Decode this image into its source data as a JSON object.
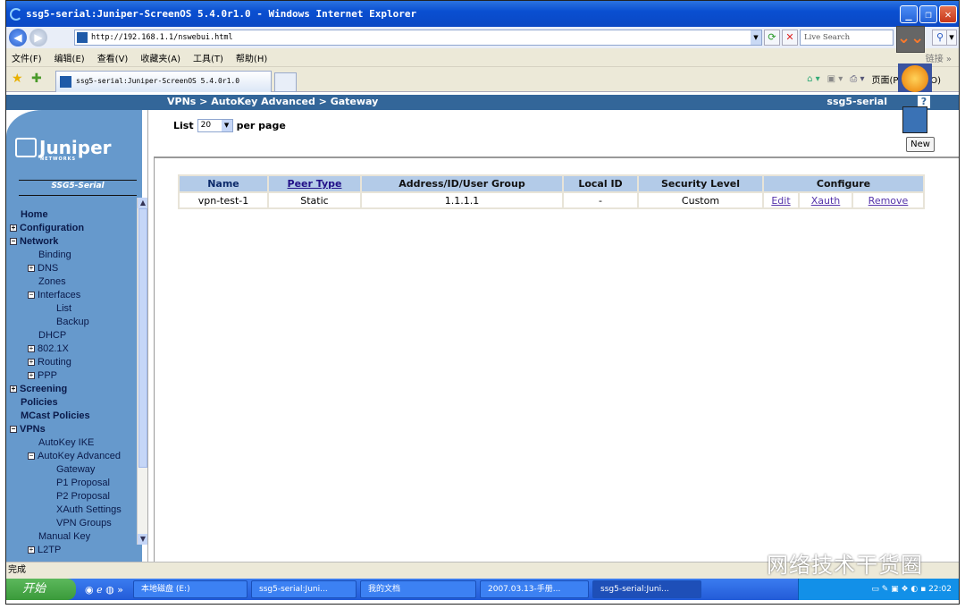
{
  "window": {
    "title": "ssg5-serial:Juniper-ScreenOS 5.4.0r1.0 - Windows Internet Explorer",
    "controls": [
      "_",
      "❐",
      "✕"
    ]
  },
  "address_bar": {
    "url": "http://192.168.1.1/nswebui.html",
    "search_placeholder": "Live Search"
  },
  "menu": {
    "items": [
      "文件(F)",
      "编辑(E)",
      "查看(V)",
      "收藏夹(A)",
      "工具(T)",
      "帮助(H)"
    ],
    "links_label": "链接 »"
  },
  "tab_bar": {
    "tab_title": "ssg5-serial:Juniper-ScreenOS 5.4.0r1.0",
    "page_menu": "页面(P)",
    "tools_menu": "工具(O)"
  },
  "header": {
    "breadcrumb": "VPNs > AutoKey Advanced > Gateway",
    "device_name": "ssg5-serial",
    "help": "?"
  },
  "sidebar": {
    "logo": "Juniper",
    "logo_sub": "NETWORKS",
    "model": "SSG5-Serial",
    "tree": [
      {
        "label": "Home",
        "bold": true,
        "level": 0,
        "toggle": ""
      },
      {
        "label": "Configuration",
        "bold": true,
        "level": 0,
        "toggle": "+"
      },
      {
        "label": "Network",
        "bold": true,
        "level": 0,
        "toggle": "−"
      },
      {
        "label": "Binding",
        "level": 1,
        "toggle": ""
      },
      {
        "label": "DNS",
        "level": 1,
        "toggle": "+"
      },
      {
        "label": "Zones",
        "level": 1,
        "toggle": ""
      },
      {
        "label": "Interfaces",
        "level": 1,
        "toggle": "−"
      },
      {
        "label": "List",
        "level": 2,
        "toggle": ""
      },
      {
        "label": "Backup",
        "level": 2,
        "toggle": ""
      },
      {
        "label": "DHCP",
        "level": 1,
        "toggle": ""
      },
      {
        "label": "802.1X",
        "level": 1,
        "toggle": "+"
      },
      {
        "label": "Routing",
        "level": 1,
        "toggle": "+"
      },
      {
        "label": "PPP",
        "level": 1,
        "toggle": "+"
      },
      {
        "label": "Screening",
        "bold": true,
        "level": 0,
        "toggle": "+"
      },
      {
        "label": "Policies",
        "bold": true,
        "level": 0,
        "toggle": ""
      },
      {
        "label": "MCast Policies",
        "bold": true,
        "level": 0,
        "toggle": ""
      },
      {
        "label": "VPNs",
        "bold": true,
        "level": 0,
        "toggle": "−"
      },
      {
        "label": "AutoKey IKE",
        "level": 1,
        "toggle": ""
      },
      {
        "label": "AutoKey Advanced",
        "level": 1,
        "toggle": "−"
      },
      {
        "label": "Gateway",
        "level": 2,
        "toggle": ""
      },
      {
        "label": "P1 Proposal",
        "level": 2,
        "toggle": ""
      },
      {
        "label": "P2 Proposal",
        "level": 2,
        "toggle": ""
      },
      {
        "label": "XAuth Settings",
        "level": 2,
        "toggle": ""
      },
      {
        "label": "VPN Groups",
        "level": 2,
        "toggle": ""
      },
      {
        "label": "Manual Key",
        "level": 1,
        "toggle": ""
      },
      {
        "label": "L2TP",
        "level": 1,
        "toggle": "+"
      }
    ]
  },
  "content": {
    "list_label": "List",
    "per_page_value": "20",
    "per_page_label": "per page",
    "new_button": "New",
    "table": {
      "headers": [
        "Name",
        "Peer Type",
        "Address/ID/User Group",
        "Local ID",
        "Security Level",
        "Configure"
      ],
      "rows": [
        {
          "name": "vpn-test-1",
          "peer_type": "Static",
          "address": "1.1.1.1",
          "local_id": "-",
          "security_level": "Custom",
          "actions": [
            "Edit",
            "Xauth",
            "Remove"
          ]
        }
      ]
    }
  },
  "status_bar": {
    "text": "完成",
    "watermark": "网络技术干货圈"
  },
  "taskbar": {
    "start": "开始",
    "tasks": [
      "本地磁盘 (E:)",
      "ssg5-serial:Juni...",
      "我的文档",
      "2007.03.13-手册...",
      "ssg5-serial:Juni..."
    ],
    "clock": "22:02"
  }
}
